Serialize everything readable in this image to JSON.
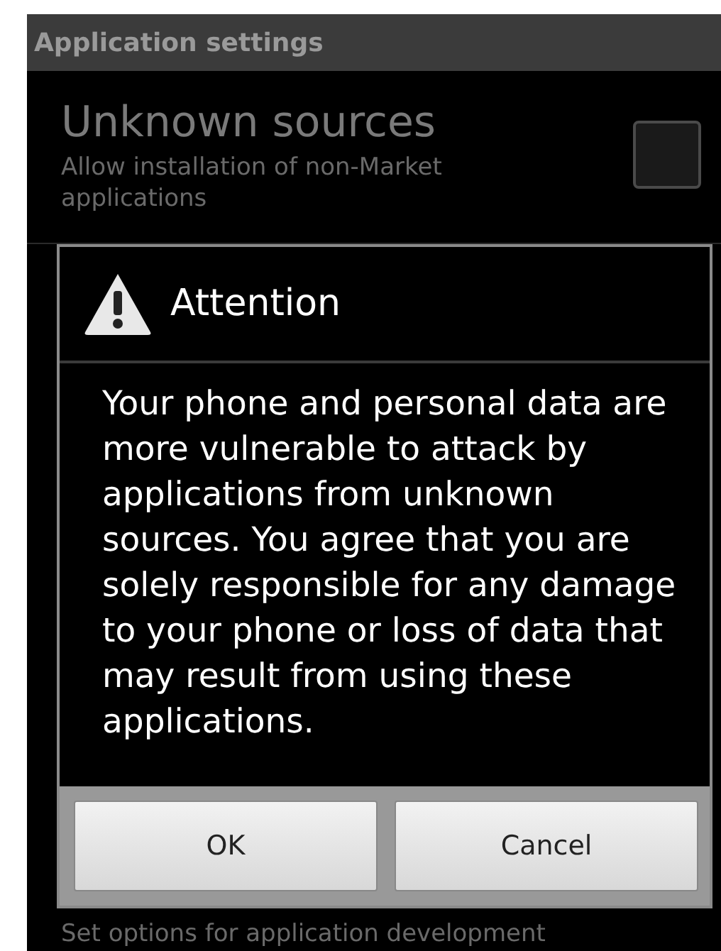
{
  "title_bar": {
    "title": "Application settings"
  },
  "settings": [
    {
      "title": "Unknown sources",
      "summary": "Allow installation of non-Market applications",
      "checked": false
    }
  ],
  "bottom_summary": "Set options for application development",
  "dialog": {
    "title": "Attention",
    "message": "Your phone and personal data are more vulnerable to attack by applications from unknown sources. You agree that you are solely responsible for any damage to your phone or loss of data that may result from using these applications.",
    "buttons": [
      "OK",
      "Cancel"
    ]
  }
}
